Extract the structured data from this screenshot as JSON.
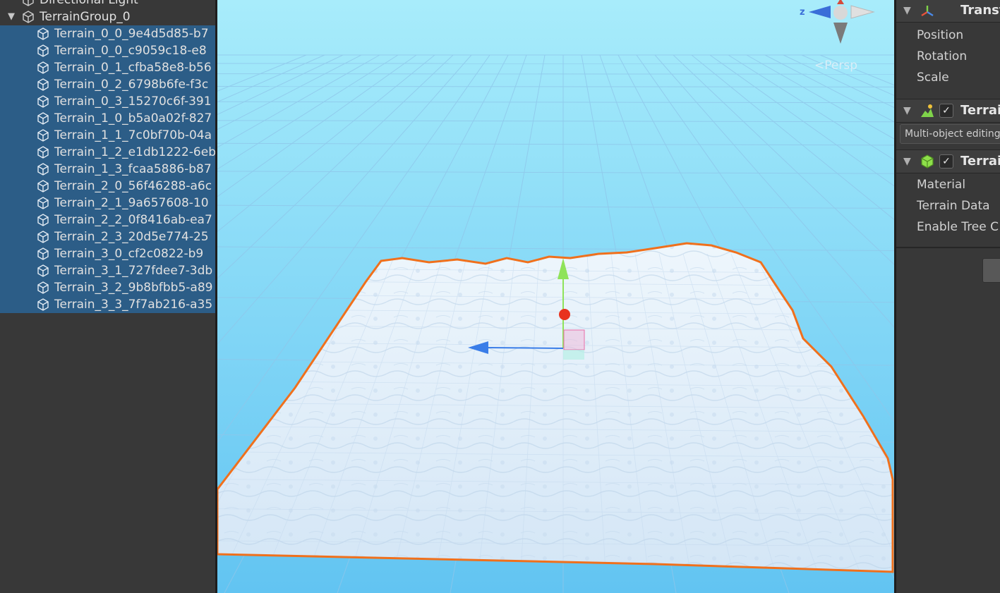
{
  "hierarchy": {
    "partial_top": "Directional Light",
    "group": "TerrainGroup_0",
    "items": [
      "Terrain_0_0_9e4d5d85-b7",
      "Terrain_0_0_c9059c18-e8",
      "Terrain_0_1_cfba58e8-b56",
      "Terrain_0_2_6798b6fe-f3c",
      "Terrain_0_3_15270c6f-391",
      "Terrain_1_0_b5a0a02f-827",
      "Terrain_1_1_7c0bf70b-04a",
      "Terrain_1_2_e1db1222-6eb",
      "Terrain_1_3_fcaa5886-b87",
      "Terrain_2_0_56f46288-a6c",
      "Terrain_2_1_9a657608-10",
      "Terrain_2_2_0f8416ab-ea7",
      "Terrain_2_3_20d5e774-25",
      "Terrain_3_0_cf2c0822-b9",
      "Terrain_3_1_727fdee7-3db",
      "Terrain_3_2_9b8bfbb5-a89",
      "Terrain_3_3_7f7ab216-a35"
    ]
  },
  "scene": {
    "gizmo_axis_label": "z",
    "projection_label": "<Persp",
    "colors": {
      "sky_top": "#a8ecfb",
      "sky_bottom": "#62c4f2",
      "selection_outline": "#f0701c",
      "terrain": "#dcebf8",
      "axis_y": "#8fe35a",
      "axis_z": "#3a7de8",
      "pivot": "#e8321e"
    }
  },
  "inspector": {
    "transform": {
      "title": "Transf",
      "position_label": "Position",
      "rotation_label": "Rotation",
      "scale_label": "Scale"
    },
    "terrain_component": {
      "title": "Terrai",
      "checked": "✓",
      "note": "Multi-object editing"
    },
    "terrain_collider": {
      "title": "Terrai",
      "checked": "✓",
      "material_label": "Material",
      "terrain_data_label": "Terrain Data",
      "enable_tree_label": "Enable Tree C"
    }
  }
}
